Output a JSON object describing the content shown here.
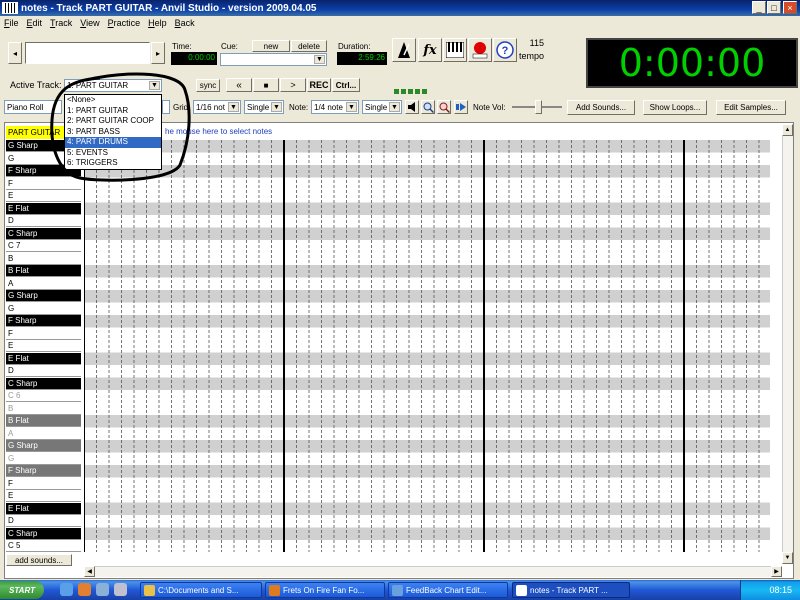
{
  "window": {
    "title": "notes - Track PART GUITAR - Anvil Studio - version 2009.04.05"
  },
  "menu": [
    "File",
    "Edit",
    "Track",
    "View",
    "Practice",
    "Help",
    "Back"
  ],
  "transport": {
    "time_label": "Time:",
    "time_value": "0:00:00",
    "cue_label": "Cue:",
    "new_label": "new",
    "delete_label": "delete",
    "duration_label": "Duration:",
    "duration_value": "2:59:26",
    "tempo_value": "115",
    "tempo_label": "tempo",
    "big_clock": "0:00:00"
  },
  "track": {
    "active_label": "Active Track:",
    "selected": "1: PART GUITAR",
    "sync_label": "sync",
    "rewind_label": "«",
    "stop_label": "■",
    "play_label": ">",
    "rec_label": "REC",
    "ctrl_label": "Ctrl..."
  },
  "dropdown_options": [
    {
      "label": "<None>",
      "selected": false
    },
    {
      "label": "1: PART GUITAR",
      "selected": false
    },
    {
      "label": "2: PART GUITAR COOP",
      "selected": false
    },
    {
      "label": "3: PART BASS",
      "selected": false
    },
    {
      "label": "4: PART DRUMS",
      "selected": true
    },
    {
      "label": "5: EVENTS",
      "selected": false
    },
    {
      "label": "6: TRIGGERS",
      "selected": false
    }
  ],
  "toolbar2": {
    "view_mode": "Piano Roll",
    "grid_label": "Grid:",
    "grid_value": "1/16 not",
    "grid_mode": "Single",
    "note_label": "Note:",
    "note_value": "1/4 note",
    "note_mode": "Single",
    "note_vol_label": "Note Vol:",
    "add_sounds_label": "Add Sounds...",
    "show_loops_label": "Show Loops...",
    "edit_samples_label": "Edit Samples..."
  },
  "piano_roll": {
    "track_tag": "PART GUITAR",
    "hint": "he mouse here to select notes",
    "add_sounds_bottom": "add sounds..."
  },
  "notes": [
    {
      "name": "G Sharp",
      "black": true,
      "dim": false
    },
    {
      "name": "G",
      "black": false,
      "dim": false
    },
    {
      "name": "F Sharp",
      "black": true,
      "dim": false
    },
    {
      "name": "F",
      "black": false,
      "dim": false
    },
    {
      "name": "E",
      "black": false,
      "dim": false
    },
    {
      "name": "E Flat",
      "black": true,
      "dim": false
    },
    {
      "name": "D",
      "black": false,
      "dim": false
    },
    {
      "name": "C Sharp",
      "black": true,
      "dim": false
    },
    {
      "name": "C 7",
      "black": false,
      "dim": false
    },
    {
      "name": "B",
      "black": false,
      "dim": false
    },
    {
      "name": "B Flat",
      "black": true,
      "dim": false
    },
    {
      "name": "A",
      "black": false,
      "dim": false
    },
    {
      "name": "G Sharp",
      "black": true,
      "dim": false
    },
    {
      "name": "G",
      "black": false,
      "dim": false
    },
    {
      "name": "F Sharp",
      "black": true,
      "dim": false
    },
    {
      "name": "F",
      "black": false,
      "dim": false
    },
    {
      "name": "E",
      "black": false,
      "dim": false
    },
    {
      "name": "E Flat",
      "black": true,
      "dim": false
    },
    {
      "name": "D",
      "black": false,
      "dim": false
    },
    {
      "name": "C Sharp",
      "black": true,
      "dim": false
    },
    {
      "name": "C 6",
      "black": false,
      "dim": true
    },
    {
      "name": "B",
      "black": false,
      "dim": true
    },
    {
      "name": "B Flat",
      "black": true,
      "dim": true
    },
    {
      "name": "A",
      "black": false,
      "dim": true
    },
    {
      "name": "G Sharp",
      "black": true,
      "dim": true
    },
    {
      "name": "G",
      "black": false,
      "dim": true
    },
    {
      "name": "F Sharp",
      "black": true,
      "dim": true
    },
    {
      "name": "F",
      "black": false,
      "dim": false
    },
    {
      "name": "E",
      "black": false,
      "dim": false
    },
    {
      "name": "E Flat",
      "black": true,
      "dim": false
    },
    {
      "name": "D",
      "black": false,
      "dim": false
    },
    {
      "name": "C Sharp",
      "black": true,
      "dim": false
    },
    {
      "name": "C 5",
      "black": false,
      "dim": false
    }
  ],
  "taskbar": {
    "start_label": "start",
    "tasks": [
      {
        "label": "C:\\Documents and S...",
        "active": false,
        "color": "#e8c04a"
      },
      {
        "label": "Frets On Fire Fan Fo...",
        "active": false,
        "color": "#e07a1f"
      },
      {
        "label": "FeedBack Chart Edit...",
        "active": false,
        "color": "#6aa0e0"
      },
      {
        "label": "notes - Track PART ...",
        "active": true,
        "color": "#ffffff"
      }
    ],
    "clock": "08:15"
  },
  "colors": {
    "accent": "#316ac5",
    "clock_green": "#00d000",
    "highlight": "#ffff00"
  },
  "icons": [
    "metronome-icon",
    "fx-icon",
    "piano-icon",
    "record-icon",
    "help-icon",
    "speaker-icon",
    "zoom-in-icon",
    "zoom-out-icon",
    "play-marker-icon"
  ]
}
